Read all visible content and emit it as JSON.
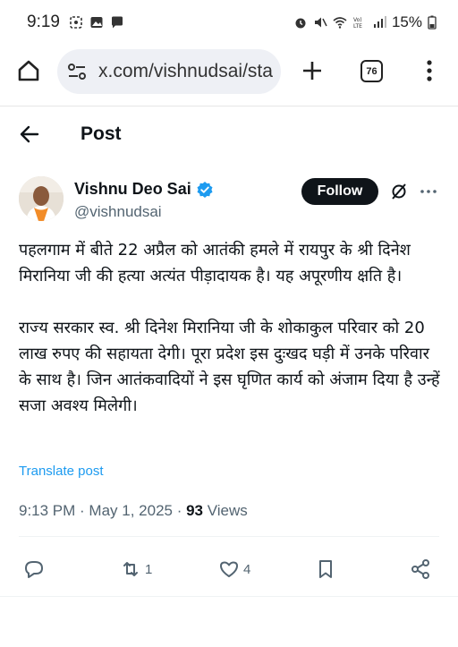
{
  "status_bar": {
    "time": "9:19",
    "battery": "15%"
  },
  "browser": {
    "url": "x.com/vishnudsai/sta",
    "tab_count": "76"
  },
  "header": {
    "title": "Post"
  },
  "author": {
    "name": "Vishnu Deo Sai",
    "handle": "@vishnudsai",
    "follow_label": "Follow"
  },
  "post": {
    "paragraph1": "पहलगाम में बीते 22 अप्रैल को आतंकी हमले में रायपुर के श्री दिनेश मिरानिया जी की हत्या अत्यंत पीड़ादायक है। यह अपूरणीय क्षति है।",
    "paragraph2": "राज्य सरकार स्व. श्री दिनेश मिरानिया जी के शोकाकुल परिवार को 20 लाख रुपए की सहायता देगी। पूरा प्रदेश इस दुःखद घड़ी में उनके परिवार के साथ है। जिन आतंकवादियों ने इस घृणित कार्य को अंजाम दिया है उन्हें सजा अवश्य मिलेगी।",
    "translate_label": "Translate post",
    "timestamp": "9:13 PM · May 1, 2025 · ",
    "views_count": "93",
    "views_label": " Views"
  },
  "actions": {
    "reply_count": "",
    "repost_count": "1",
    "like_count": "4"
  }
}
